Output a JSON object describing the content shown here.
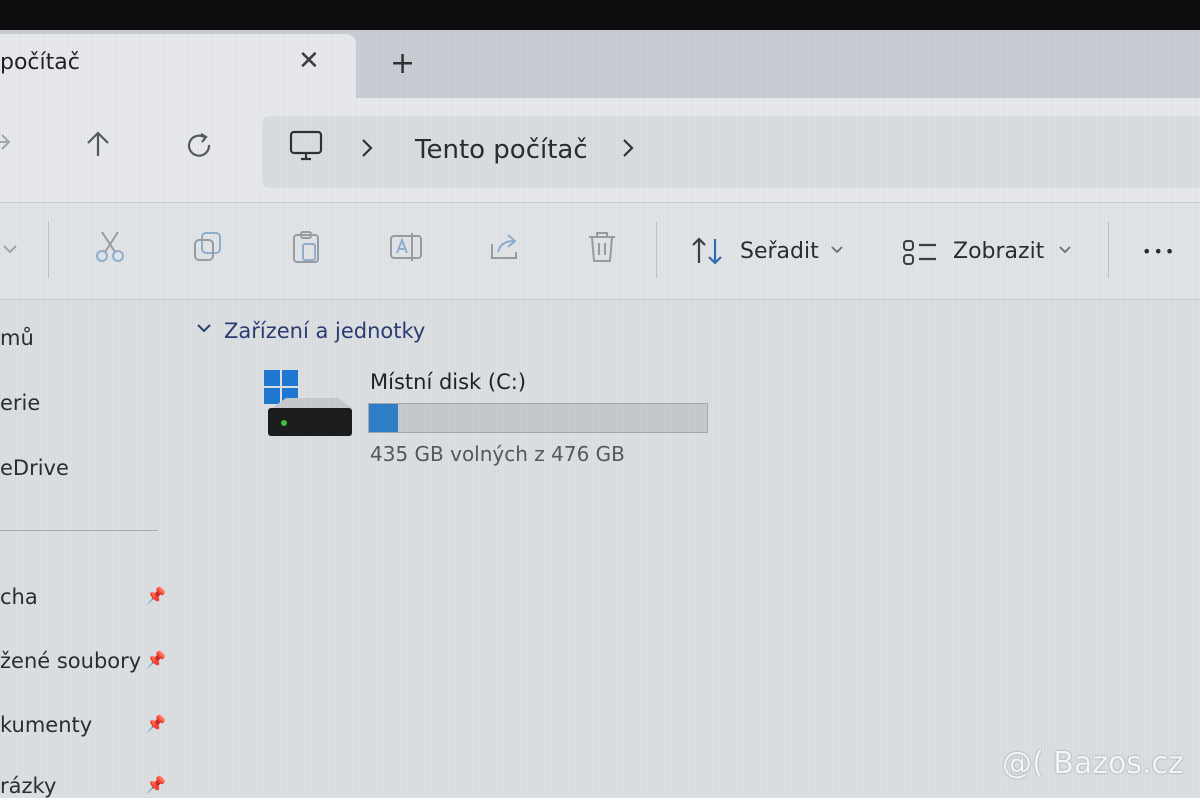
{
  "tab": {
    "title": "počítač",
    "close_glyph": "✕",
    "new_tab_glyph": "+"
  },
  "nav": {
    "back_icon": "arrow-right-icon",
    "up_icon": "arrow-up-icon",
    "refresh_icon": "refresh-icon",
    "breadcrumb_location": "Tento počítač",
    "breadcrumb_icon": "monitor-icon"
  },
  "toolbar": {
    "sort_label": "Seřadit",
    "view_label": "Zobrazit",
    "more_glyph": "•••",
    "icons": [
      "cut-icon",
      "copy-icon",
      "paste-icon",
      "rename-icon",
      "share-icon",
      "delete-icon"
    ]
  },
  "sidebar": {
    "items": [
      {
        "label": "mů",
        "pinned": false
      },
      {
        "label": "erie",
        "pinned": false
      },
      {
        "label": "eDrive",
        "pinned": false
      },
      {
        "label": "cha",
        "pinned": true
      },
      {
        "label": "žené soubory",
        "pinned": true
      },
      {
        "label": "kumenty",
        "pinned": true
      },
      {
        "label": "rázky",
        "pinned": true
      }
    ]
  },
  "section": {
    "title": "Zařízení a jednotky"
  },
  "drive": {
    "name": "Místní disk (C:)",
    "info": "435 GB volných z 476 GB",
    "used_fraction": 0.086,
    "bar_color": "#2f7fc8"
  },
  "watermark": "@( Bazos.cz",
  "colors": {
    "accent": "#2f7fc8",
    "section_title": "#2c3c72",
    "background": "#dcdfe2"
  }
}
